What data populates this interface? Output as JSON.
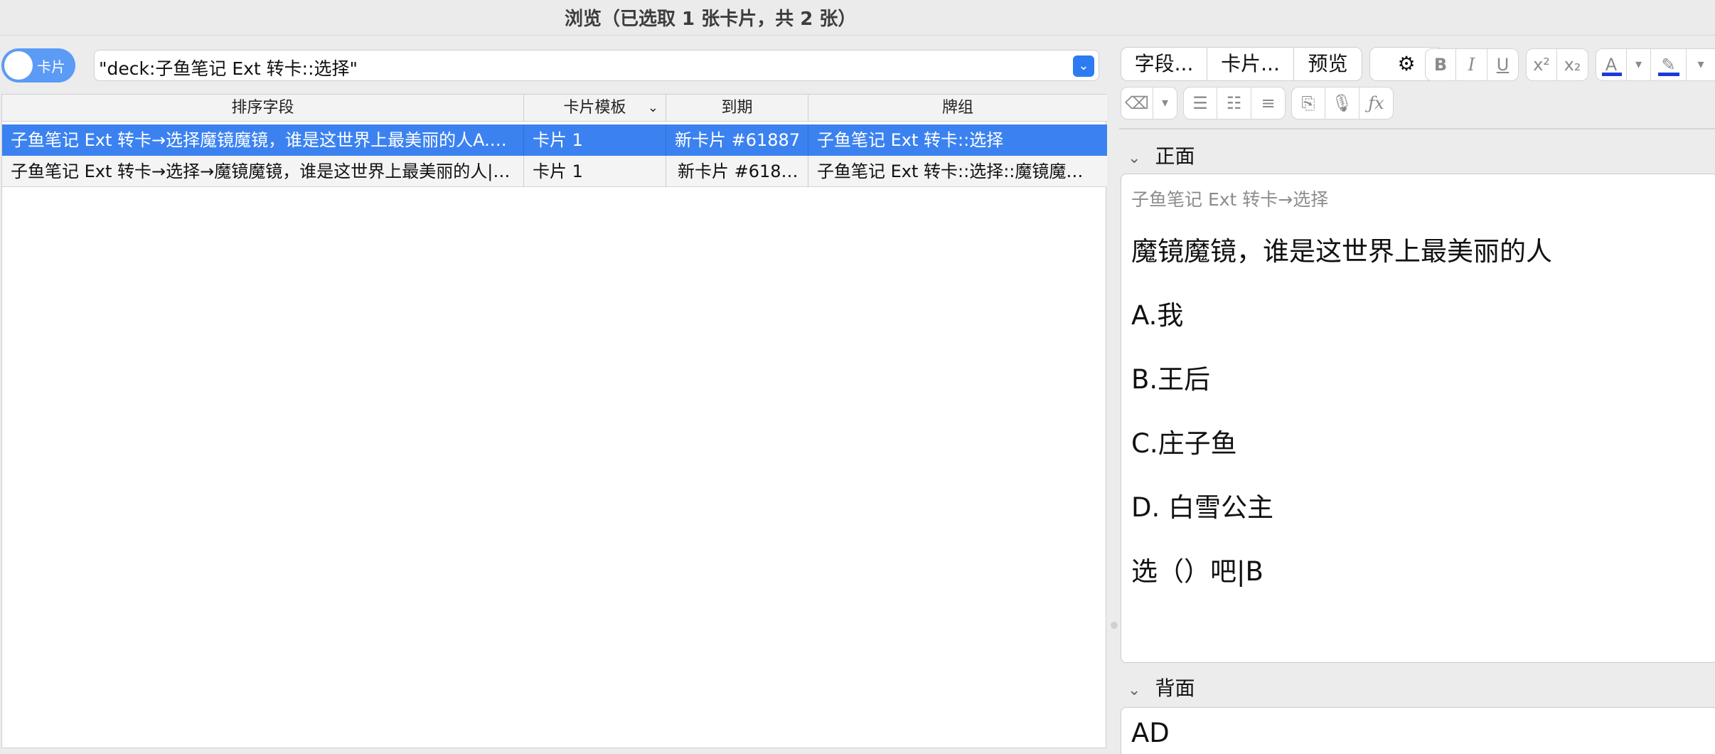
{
  "window": {
    "title": "浏览（已选取 1 张卡片，共 2 张）"
  },
  "toggle": {
    "label": "卡片"
  },
  "search": {
    "value": "\"deck:子鱼笔记 Ext 转卡::选择\""
  },
  "table": {
    "columns": [
      "排序字段",
      "卡片模板",
      "到期",
      "牌组"
    ],
    "rows": [
      {
        "sort_field": "子鱼笔记 Ext 转卡→选择魔镜魔镜，谁是这世界上最美丽的人A.…",
        "template": "卡片 1",
        "due": "新卡片 #61887",
        "deck": "子鱼笔记 Ext 转卡::选择",
        "selected": true
      },
      {
        "sort_field": "子鱼笔记 Ext 转卡→选择→魔镜魔镜，谁是这世界上最美丽的人|…",
        "template": "卡片 1",
        "due": "新卡片 #618…",
        "deck": "子鱼笔记 Ext 转卡::选择::魔镜魔…",
        "selected": false
      }
    ]
  },
  "editor": {
    "buttons": {
      "fields": "字段...",
      "cards": "卡片...",
      "preview": "预览"
    },
    "format_icons": [
      "B",
      "I",
      "U",
      "x²",
      "x₂",
      "A",
      "▾",
      "✎",
      "▾"
    ],
    "toolbar2_icons": [
      "⌫",
      "▾",
      "☰",
      "☷",
      "≡",
      "⎘",
      "🎙",
      "ƒx"
    ],
    "front": {
      "label": "正面",
      "breadcrumb": "子鱼笔记 Ext 转卡→选择",
      "lines": [
        "魔镜魔镜，谁是这世界上最美丽的人",
        "A.我",
        "B.王后",
        "C.庄子鱼",
        "D. 白雪公主",
        "选（）吧|B"
      ]
    },
    "back": {
      "label": "背面",
      "text": "AD"
    }
  },
  "colors": {
    "accent": "#3b82f0",
    "text_color_bar": "#1a3cd6"
  }
}
